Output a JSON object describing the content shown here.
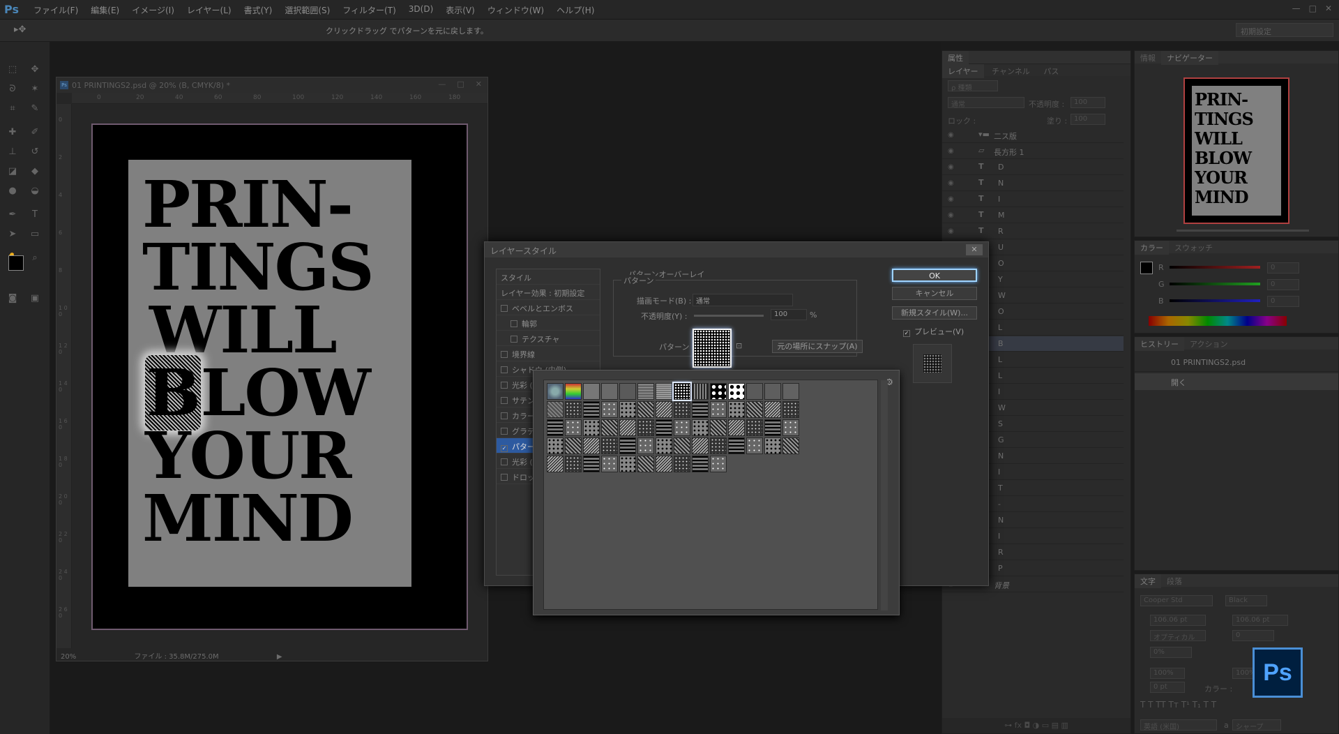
{
  "menubar": {
    "app_logo": "Ps",
    "items": [
      "ファイル(F)",
      "編集(E)",
      "イメージ(I)",
      "レイヤー(L)",
      "書式(Y)",
      "選択範囲(S)",
      "フィルター(T)",
      "3D(D)",
      "表示(V)",
      "ウィンドウ(W)",
      "ヘルプ(H)"
    ],
    "window_controls": [
      "—",
      "□",
      "✕"
    ]
  },
  "optionsbar": {
    "tool_icon": "move-icon",
    "hint": "クリックドラッグ でパターンを元に戻します。",
    "preset": "初期設定"
  },
  "document": {
    "title": "01 PRINTINGS2.psd @ 20% (B, CMYK/8) *",
    "ruler_ticks": [
      "0",
      "20",
      "40",
      "60",
      "80",
      "100",
      "120",
      "140",
      "160",
      "180"
    ],
    "vertical_ruler_ticks": [
      "0",
      "2",
      "4",
      "6",
      "8",
      "1 0 0",
      "1 2 0",
      "1 4 0",
      "1 6 0",
      "1 8 0",
      "2 0 0",
      "2 2 0",
      "2 4 0",
      "2 6 0"
    ],
    "zoom": "20%",
    "file_info": "ファイル : 35.8M/275.0M",
    "poster_lines": [
      "PRIN-",
      "TINGS",
      "WILL",
      "B",
      "LOW",
      "YOUR",
      "MIND"
    ]
  },
  "panels": {
    "properties_tab": "属性",
    "layers_tabs": [
      "レイヤー",
      "チャンネル",
      "パス"
    ],
    "kind_filter": "ρ 種類",
    "blend_mode": "通常",
    "opacity_label": "不透明度 :",
    "opacity_value": "100",
    "lock_label": "ロック :",
    "fill_label": "塗り :",
    "fill_value": "100",
    "layers": [
      {
        "name": "二ス版",
        "type": "group"
      },
      {
        "name": "長方形 1",
        "type": "shape"
      },
      {
        "name": "D",
        "type": "text"
      },
      {
        "name": "N",
        "type": "text"
      },
      {
        "name": "I",
        "type": "text"
      },
      {
        "name": "M",
        "type": "text"
      },
      {
        "name": "R",
        "type": "text"
      },
      {
        "name": "U",
        "type": "text"
      },
      {
        "name": "O",
        "type": "text"
      },
      {
        "name": "Y",
        "type": "text"
      },
      {
        "name": "W",
        "type": "text"
      },
      {
        "name": "O",
        "type": "text"
      },
      {
        "name": "L",
        "type": "text"
      },
      {
        "name": "B",
        "type": "text"
      },
      {
        "name": "L",
        "type": "text"
      },
      {
        "name": "L",
        "type": "text"
      },
      {
        "name": "I",
        "type": "text"
      },
      {
        "name": "W",
        "type": "text"
      },
      {
        "name": "S",
        "type": "text"
      },
      {
        "name": "G",
        "type": "text"
      },
      {
        "name": "N",
        "type": "text"
      },
      {
        "name": "I",
        "type": "text"
      },
      {
        "name": "T",
        "type": "text"
      },
      {
        "name": "-",
        "type": "text"
      },
      {
        "name": "N",
        "type": "text"
      },
      {
        "name": "I",
        "type": "text"
      },
      {
        "name": "R",
        "type": "text"
      },
      {
        "name": "P",
        "type": "text"
      },
      {
        "name": "背景",
        "type": "background"
      }
    ],
    "info_tabs": [
      "情報",
      "ナビゲーター"
    ],
    "navigator_lines": [
      "PRIN-",
      "TINGS",
      "WILL",
      "BLOW",
      "YOUR",
      "MIND"
    ],
    "color_tabs": [
      "カラー",
      "スウォッチ"
    ],
    "color_channels": [
      {
        "label": "R",
        "value": "0"
      },
      {
        "label": "G",
        "value": "0"
      },
      {
        "label": "B",
        "value": "0"
      }
    ],
    "history_tabs": [
      "ヒストリー",
      "アクション"
    ],
    "history_items": [
      "01 PRINTINGS2.psd",
      "開く"
    ],
    "char_tabs": [
      "文字",
      "段落"
    ],
    "font_family": "Cooper Std",
    "font_style": "Black",
    "font_size": "106.06 pt",
    "leading": "106.06 pt",
    "kerning": "オプティカル",
    "tracking": "0",
    "scale": "0%",
    "vscale": "100%",
    "hscale": "100%",
    "baseline": "0 pt",
    "color_label": "カラー :",
    "language": "英語 (米国)",
    "aa_label": "a",
    "aa_value": "シャープ"
  },
  "dialog": {
    "title": "レイヤースタイル",
    "close": "✕",
    "style_header": "スタイル",
    "effects_default": "レイヤー効果 : 初期設定",
    "effects": [
      {
        "label": "ベベルとエンボス",
        "checked": false
      },
      {
        "label": "輪郭",
        "checked": false,
        "sub": true
      },
      {
        "label": "テクスチャ",
        "checked": false,
        "sub": true
      },
      {
        "label": "境界線",
        "checked": false
      },
      {
        "label": "シャドウ (内側)",
        "checked": false
      },
      {
        "label": "光彩 (内側)",
        "checked": false
      },
      {
        "label": "サテン",
        "checked": false
      },
      {
        "label": "カラーオーバーレイ",
        "checked": false
      },
      {
        "label": "グラデーションオーバーレイ",
        "checked": false
      },
      {
        "label": "パターンオーバーレイ",
        "checked": true
      },
      {
        "label": "光彩 (外側)",
        "checked": false
      },
      {
        "label": "ドロップシャドウ",
        "checked": false
      }
    ],
    "section_title": "パターンオーバーレイ",
    "group_title": "パターン",
    "blend_label": "描画モード(B) :",
    "blend_value": "通常",
    "opacity_label": "不透明度(Y) :",
    "opacity_value": "100",
    "opacity_unit": "%",
    "pattern_label": "パターン :",
    "snap_button": "元の場所にスナップ(A)",
    "ok": "OK",
    "cancel": "キャンセル",
    "new_style": "新規スタイル(W)...",
    "preview_label": "プレビュー(V)",
    "preview_checked": true
  },
  "pattern_picker": {
    "gear_icon": "gear-icon",
    "selected_index": 7,
    "swatch_count": 66
  },
  "ps_badge": "Ps"
}
